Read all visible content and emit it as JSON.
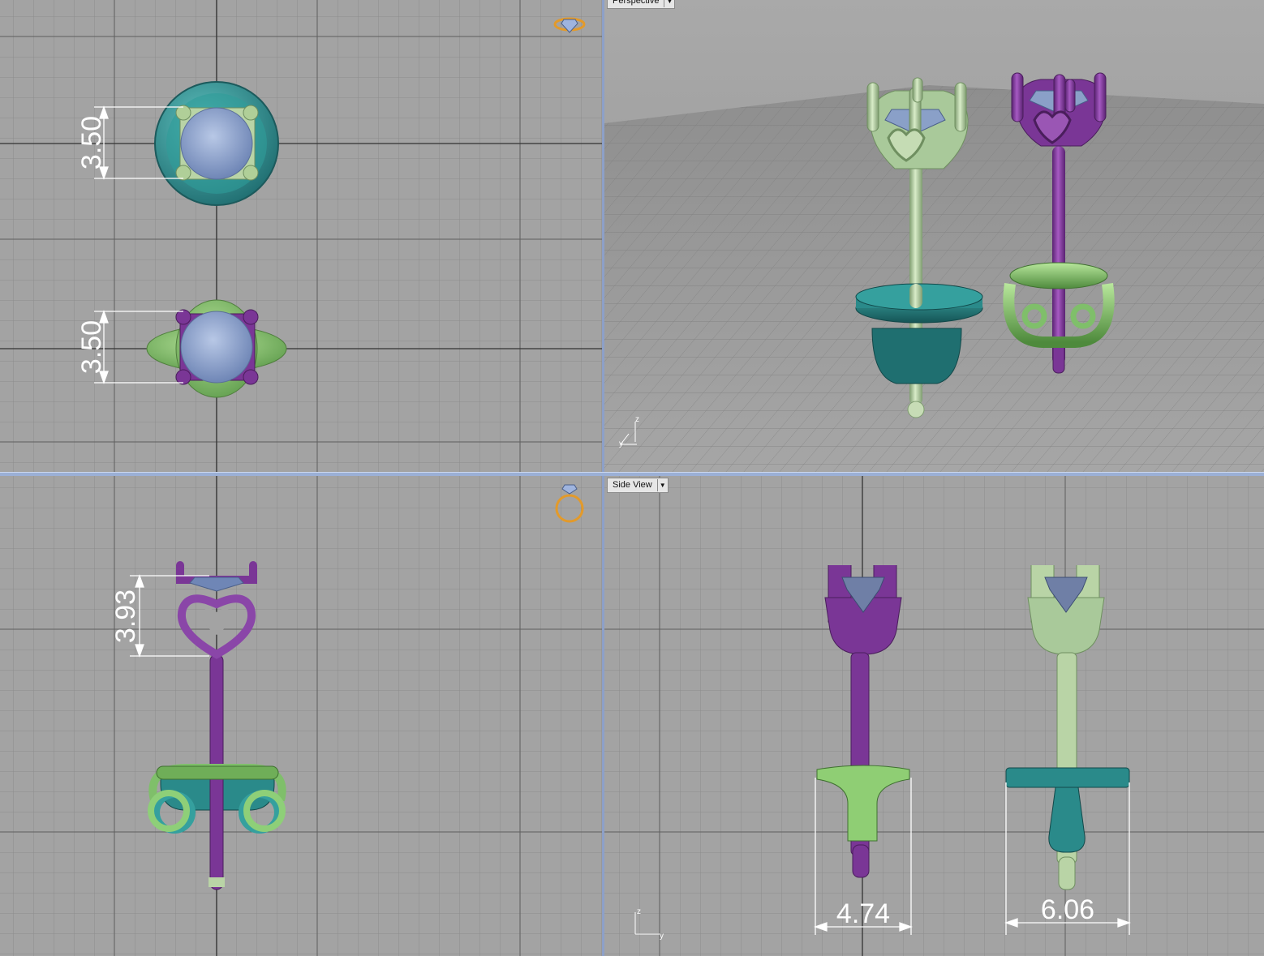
{
  "viewports": {
    "top": {
      "label": ""
    },
    "perspective": {
      "label": "Perspective"
    },
    "front": {
      "label": ""
    },
    "side": {
      "label": "Side View"
    }
  },
  "dimensions": {
    "top_upper": "3.50",
    "top_lower": "3.50",
    "front_head": "3.93",
    "side_left_width": "4.74",
    "side_right_width": "6.06"
  },
  "axes": {
    "z": "z",
    "y": "y"
  },
  "colors": {
    "background": "#a3a3a3",
    "grid_minor": "#8c8c8c",
    "grid_major": "#5e5e5e",
    "teal_metal": "#2a8a8a",
    "purple_metal": "#7a3696",
    "green_metal": "#7fbf6a",
    "sage_metal": "#a9c99a",
    "gem": "#8aa0c8",
    "orientation_icon": "#e39a2a"
  },
  "icons": {
    "top_orientation": "ring-top-orientation-icon",
    "front_orientation": "ring-front-orientation-icon"
  }
}
